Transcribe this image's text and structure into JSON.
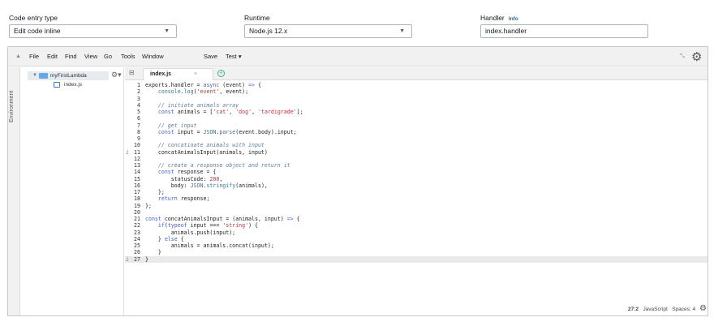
{
  "config": {
    "code_entry": {
      "label": "Code entry type",
      "value": "Edit code inline"
    },
    "runtime": {
      "label": "Runtime",
      "value": "Node.js 12.x"
    },
    "handler": {
      "label": "Handler",
      "info": "Info",
      "value": "index.handler"
    }
  },
  "menu": {
    "items": [
      "File",
      "Edit",
      "Find",
      "View",
      "Go",
      "Tools",
      "Window"
    ],
    "save": "Save",
    "test": "Test ▾"
  },
  "env_label": "Environment",
  "tree": {
    "folder": "myFirstLambda",
    "file": "index.js"
  },
  "editor": {
    "tab": "index.js",
    "lines": [
      {
        "n": "1",
        "html": "exports.handler = <span class='kw'>async</span> (event) <span class='kw'>=&gt;</span> {"
      },
      {
        "n": "2",
        "html": "    <span class='fnm'>console</span>.<span class='fnm'>log</span>(<span class='str'>'event'</span>, event);"
      },
      {
        "n": "3",
        "html": ""
      },
      {
        "n": "4",
        "html": "    <span class='cm'>// initiate animals array</span>"
      },
      {
        "n": "5",
        "html": "    <span class='kw'>const</span> animals = [<span class='str'>'cat'</span>, <span class='str'>'dog'</span>, <span class='str'>'tardigrade'</span>];"
      },
      {
        "n": "6",
        "html": ""
      },
      {
        "n": "7",
        "html": "    <span class='cm'>// get input</span>"
      },
      {
        "n": "8",
        "html": "    <span class='kw'>const</span> input = <span class='fnm'>JSON</span>.<span class='fnm'>parse</span>(event.body).input;"
      },
      {
        "n": "9",
        "html": ""
      },
      {
        "n": "10",
        "html": "    <span class='cm'>// concatinate animals with input</span>"
      },
      {
        "n": "11",
        "html": "    concatAnimalsInput(animals, input)",
        "mark": "i"
      },
      {
        "n": "12",
        "html": ""
      },
      {
        "n": "13",
        "html": "    <span class='cm'>// create a response object and return it</span>"
      },
      {
        "n": "14",
        "html": "    <span class='kw'>const</span> response = {"
      },
      {
        "n": "15",
        "html": "        statusCode: <span class='num'>200</span>,"
      },
      {
        "n": "16",
        "html": "        body: <span class='fnm'>JSON</span>.<span class='fnm'>stringify</span>(animals),"
      },
      {
        "n": "17",
        "html": "    };"
      },
      {
        "n": "18",
        "html": "    <span class='kw'>return</span> response;"
      },
      {
        "n": "19",
        "html": "};"
      },
      {
        "n": "20",
        "html": ""
      },
      {
        "n": "21",
        "html": "<span class='kw'>const</span> concatAnimalsInput = (animals, input) <span class='kw'>=&gt;</span> {"
      },
      {
        "n": "22",
        "html": "    <span class='kw'>if</span>(<span class='kw'>typeof</span> input === <span class='str'>'string'</span>) {"
      },
      {
        "n": "23",
        "html": "        animals.push(input);"
      },
      {
        "n": "24",
        "html": "    } <span class='kw'>else</span> {"
      },
      {
        "n": "25",
        "html": "        animals = animals.concat(input);"
      },
      {
        "n": "26",
        "html": "    }"
      },
      {
        "n": "27",
        "html": "}",
        "mark": "i",
        "active": true
      }
    ]
  },
  "status": {
    "position": "27:2",
    "language": "JavaScript",
    "spaces": "Spaces: 4"
  }
}
